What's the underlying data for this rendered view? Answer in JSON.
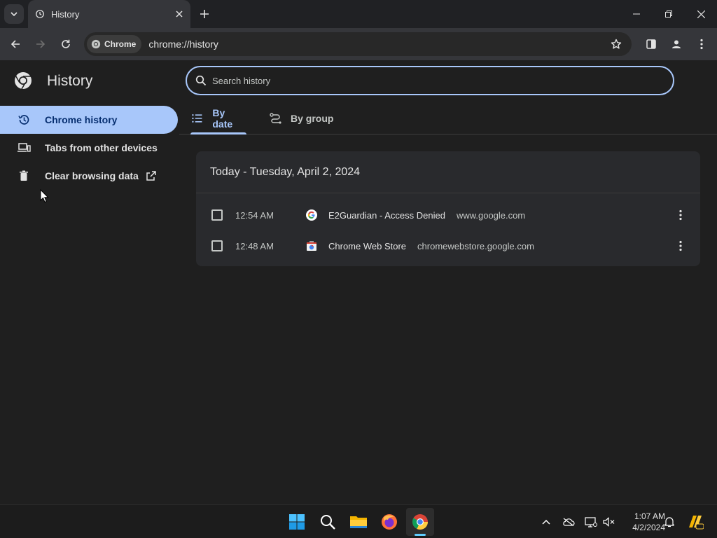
{
  "browser": {
    "tab_title": "History",
    "chip_label": "Chrome",
    "url": "chrome://history"
  },
  "sidebar": {
    "title": "History",
    "items": [
      {
        "label": "Chrome history",
        "icon": "history-icon",
        "active": true
      },
      {
        "label": "Tabs from other devices",
        "icon": "devices-icon",
        "active": false
      },
      {
        "label": "Clear browsing data",
        "icon": "trash-icon",
        "active": false
      }
    ]
  },
  "search": {
    "placeholder": "Search history"
  },
  "view_tabs": [
    {
      "label": "By date",
      "active": true
    },
    {
      "label": "By group",
      "active": false
    }
  ],
  "history": {
    "date_heading": "Today - Tuesday, April 2, 2024",
    "entries": [
      {
        "time": "12:54 AM",
        "title": "E2Guardian - Access Denied",
        "domain": "www.google.com",
        "favicon": "google-icon"
      },
      {
        "time": "12:48 AM",
        "title": "Chrome Web Store",
        "domain": "chromewebstore.google.com",
        "favicon": "web-store-icon"
      }
    ]
  },
  "taskbar": {
    "time": "1:07 AM",
    "date": "4/2/2024",
    "apps": [
      "windows-start-icon",
      "search-icon",
      "file-explorer-icon",
      "firefox-icon",
      "chrome-icon"
    ]
  },
  "colors": {
    "accent": "#a8c7fa",
    "background": "#1f1f1f",
    "card": "#292a2d"
  }
}
